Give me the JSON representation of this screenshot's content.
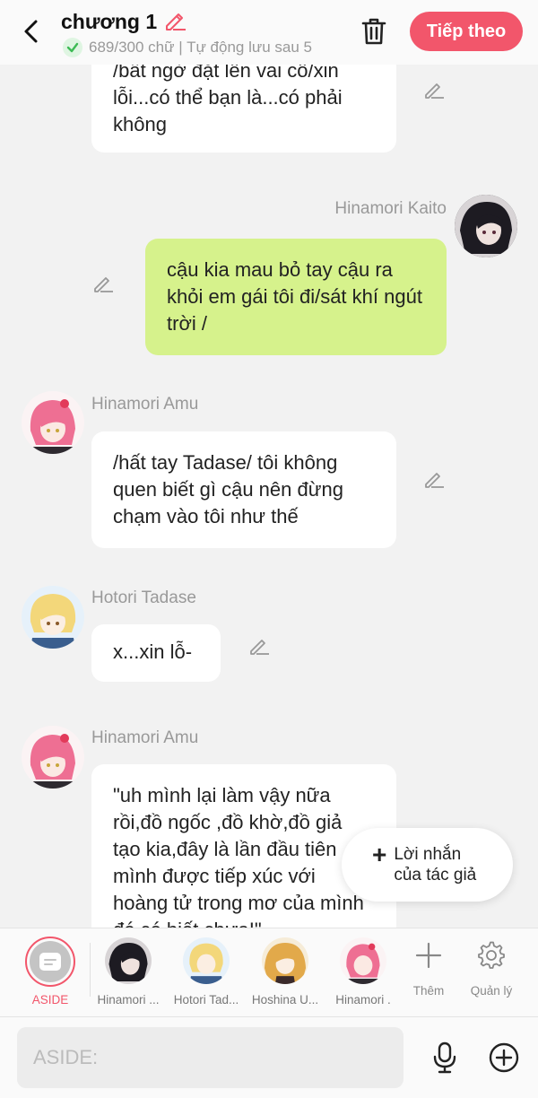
{
  "header": {
    "title": "chương 1",
    "status": "689/300 chữ | Tự động lưu sau 5",
    "next_label": "Tiếp theo"
  },
  "messages": [
    {
      "speaker": "",
      "text": "/bất ngờ đặt lên vai cô/xin lỗi...có thể bạn là...có phải không",
      "side": "left"
    },
    {
      "speaker": "Hinamori Kaito",
      "text": "cậu kia mau bỏ tay cậu ra khỏi em gái tôi đi/sát khí ngút trời /",
      "side": "right"
    },
    {
      "speaker": "Hinamori Amu",
      "text": "/hất tay Tadase/ tôi không quen biết gì cậu nên đừng chạm vào tôi như thế",
      "side": "left"
    },
    {
      "speaker": "Hotori Tadase",
      "text": "x...xin lỗ-",
      "side": "left"
    },
    {
      "speaker": "Hinamori Amu",
      "text": "\"uh mình lại làm vậy nữa rồi,đồ ngốc ,đồ khờ,đồ giả tạo kia,đây là lần đầu tiên mình được tiếp xúc với hoàng tử trong mơ của mình đó có biết chưa!\"",
      "side": "left"
    }
  ],
  "floating_note": {
    "label": "Lời nhắn của tác giả"
  },
  "characters": {
    "aside_label": "ASIDE",
    "items": [
      {
        "label": "Hinamori ..."
      },
      {
        "label": "Hotori Tad..."
      },
      {
        "label": "Hoshina U..."
      },
      {
        "label": "Hinamori ."
      }
    ],
    "add_label": "Thêm",
    "manage_label": "Quản lý"
  },
  "input": {
    "placeholder": "ASIDE:"
  },
  "colors": {
    "accent": "#f2566b",
    "my_bubble": "#d6f28c",
    "background": "#f2f2f2"
  }
}
